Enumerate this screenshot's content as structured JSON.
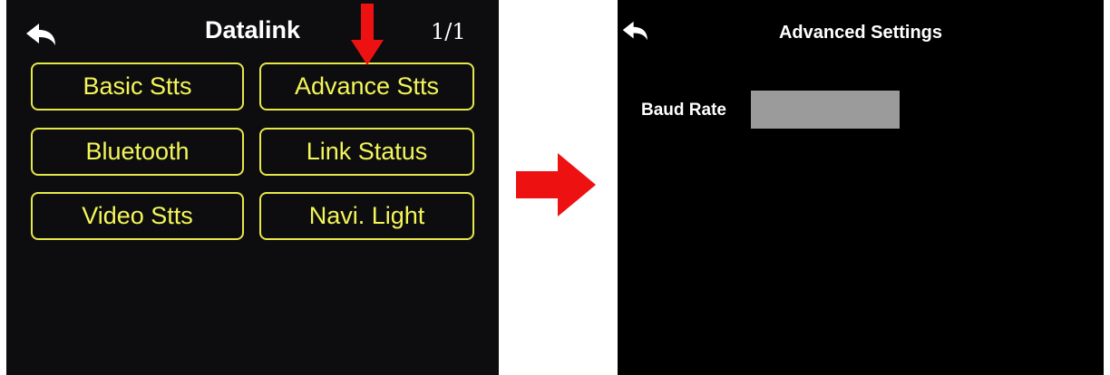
{
  "datalink_screen": {
    "title": "Datalink",
    "page_indicator": "1/1",
    "menu_items": [
      {
        "label": "Basic Stts"
      },
      {
        "label": "Advance Stts"
      },
      {
        "label": "Bluetooth"
      },
      {
        "label": "Link Status"
      },
      {
        "label": "Video Stts"
      },
      {
        "label": "Navi. Light"
      }
    ],
    "back_icon": "back-arrow-icon",
    "accent_color": "#e6e84a"
  },
  "advanced_screen": {
    "title": "Advanced Settings",
    "baud_rate_label": "Baud Rate",
    "baud_rate_value": "",
    "back_icon": "back-arrow-icon"
  },
  "annotations": {
    "pointer_icon": "down-arrow-icon",
    "transition_icon": "right-arrow-icon",
    "arrow_color": "#ee1111"
  }
}
